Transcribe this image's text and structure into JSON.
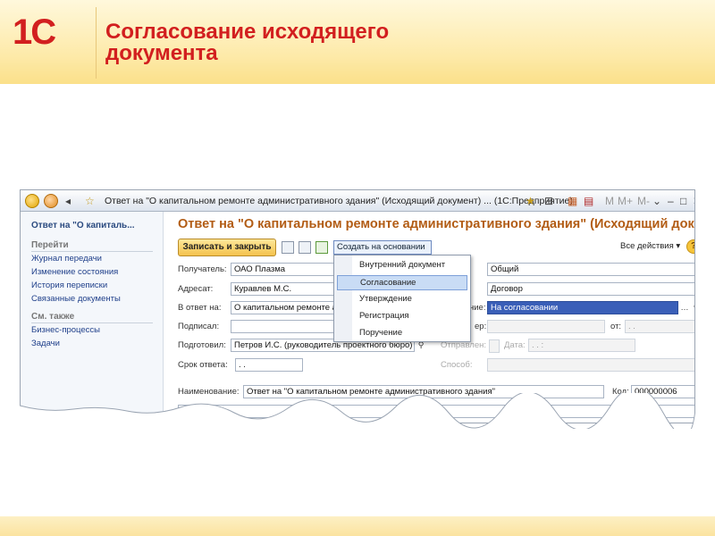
{
  "slide": {
    "logo_text": "1С",
    "title": "Согласование исходящего документа"
  },
  "window": {
    "title": "Ответ на \"О капитальном ремонте административного здания\" (Исходящий документ) ...  (1С:Предприятие)",
    "toolbar_right": [
      "M",
      "M+",
      "M-"
    ]
  },
  "left_panel": {
    "header": "Ответ на \"О капиталь...",
    "go_section": "Перейти",
    "go_links": [
      "Журнал передачи",
      "Изменение состояния",
      "История переписки",
      "Связанные документы"
    ],
    "see_also_section": "См. также",
    "see_also_links": [
      "Бизнес-процессы",
      "Задачи"
    ]
  },
  "form": {
    "title": "Ответ на \"О капитальном ремонте административного здания\" (Исходящий докум...",
    "write_close": "Записать и закрыть",
    "create_based": "Создать на основании",
    "all_actions": "Все действия",
    "help": "?",
    "fields": {
      "recipient_label": "Получатель:",
      "recipient": "ОАО Плазма",
      "addressee_label": "Адресат:",
      "addressee": "Куравлев М.С.",
      "reply_to_label": "В ответ на:",
      "reply_to": "О капитальном ремонте ад",
      "signed_label": "Подписал:",
      "signed": "",
      "prepared_label": "Подготовил:",
      "prepared": "Петров И.С. (руководитель проектного бюро)",
      "deadline_label": "Срок ответа:",
      "deadline": ". .",
      "access": "Общий",
      "doc_type": "Договор",
      "status_label": "ние:",
      "status": "На согласовании",
      "reg_label": "ер:",
      "from_label": "от:",
      "from_value": ". .",
      "sent_label": "Отправлен:",
      "date_label": "Дата:",
      "date_value": ".  .      :",
      "method_label": "Способ:",
      "name_label": "Наименование:",
      "name": "Ответ на \"О капитальном ремонте административного здания\"",
      "code_label": "Код:",
      "code": "000000006"
    }
  },
  "dropdown": {
    "items": [
      "Внутренний документ",
      "Согласование",
      "Утверждение",
      "Регистрация",
      "Поручение"
    ],
    "active_index": 1
  },
  "colors": {
    "brand_red": "#d21f1f",
    "form_title": "#b25c14",
    "link_blue": "#1f3f8a",
    "selection": "#3a5fb8"
  }
}
